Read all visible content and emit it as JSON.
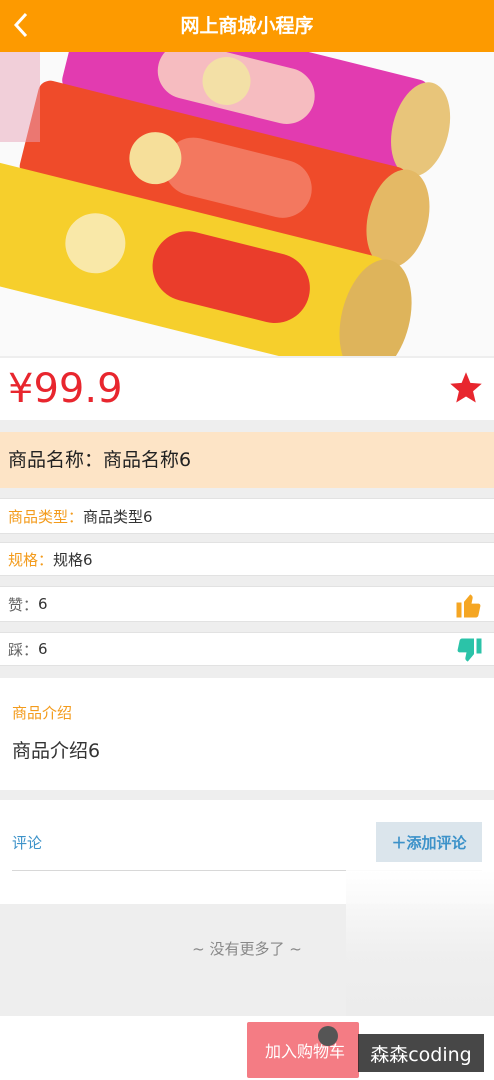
{
  "header": {
    "title": "网上商城小程序",
    "back_icon": "chevron-left-icon"
  },
  "product": {
    "price": "¥99.9",
    "favorite_icon": "star-icon",
    "name_label": "商品名称：",
    "name_value": "商品名称6",
    "type_label": "商品类型：",
    "type_value": "商品类型6",
    "spec_label": "规格：",
    "spec_value": "规格6",
    "like_label": "赞：",
    "like_value": "6",
    "dislike_label": "踩：",
    "dislike_value": "6"
  },
  "intro": {
    "label": "商品介绍",
    "text": "商品介绍6"
  },
  "comments": {
    "label": "评论",
    "add_button": "＋添加评论"
  },
  "footer": {
    "no_more": "~ 没有更多了 ~",
    "cart_button": "加入购物车",
    "watermark": "森森coding"
  },
  "colors": {
    "brand": "#fd9a00",
    "price": "#e8262e",
    "accent": "#f39b1c",
    "link": "#3c92c9",
    "like": "#f5a623",
    "dislike": "#2bc3a8"
  }
}
